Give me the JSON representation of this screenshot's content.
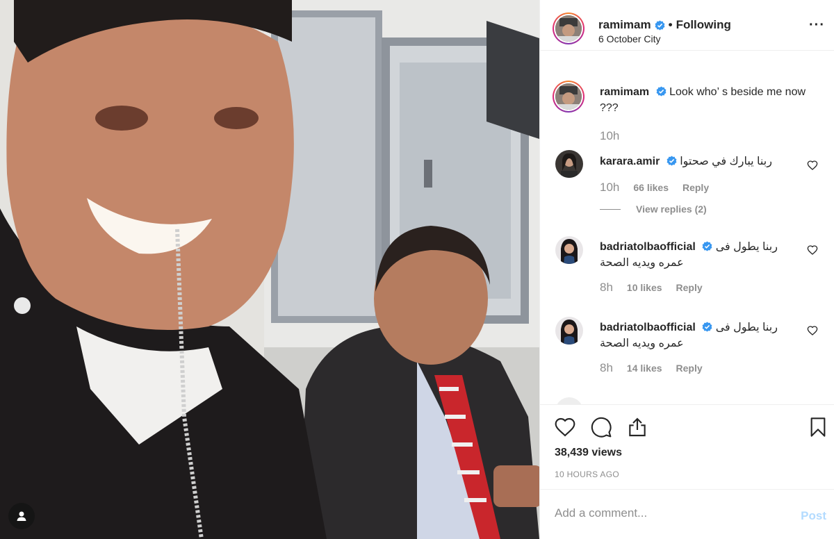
{
  "post": {
    "username": "ramimam",
    "follow_status": "Following",
    "location": "6 October City"
  },
  "caption": {
    "username": "ramimam",
    "text": "Look who’ s beside me now ???",
    "time": "10h"
  },
  "comments": [
    {
      "username": "karara.amir",
      "text": "ربنا يبارك في صحتوا",
      "time": "10h",
      "likes": "66 likes",
      "reply": "Reply",
      "view_replies": "View replies (2)"
    },
    {
      "username": "badriatolbaofficial",
      "text": "ربنا يطول فى عمره ويديه الصحة",
      "time": "8h",
      "likes": "10 likes",
      "reply": "Reply"
    },
    {
      "username": "badriatolbaofficial",
      "text": "ربنا يطول فى عمره ويديه الصحة",
      "time": "8h",
      "likes": "14 likes",
      "reply": "Reply"
    }
  ],
  "stats": {
    "views": "38,439 views",
    "posted": "10 HOURS AGO"
  },
  "add_comment": {
    "placeholder": "Add a comment...",
    "post_label": "Post"
  },
  "icons": {
    "verified": "verified-badge-icon",
    "more": "more-options-icon",
    "like": "heart-icon",
    "comment": "comment-bubble-icon",
    "share": "share-icon",
    "save": "bookmark-icon",
    "tag": "user-tag-icon"
  },
  "colors": {
    "verified_blue": "#3897f0",
    "muted": "#8e8e8e",
    "post_disabled": "#b3dbff"
  }
}
